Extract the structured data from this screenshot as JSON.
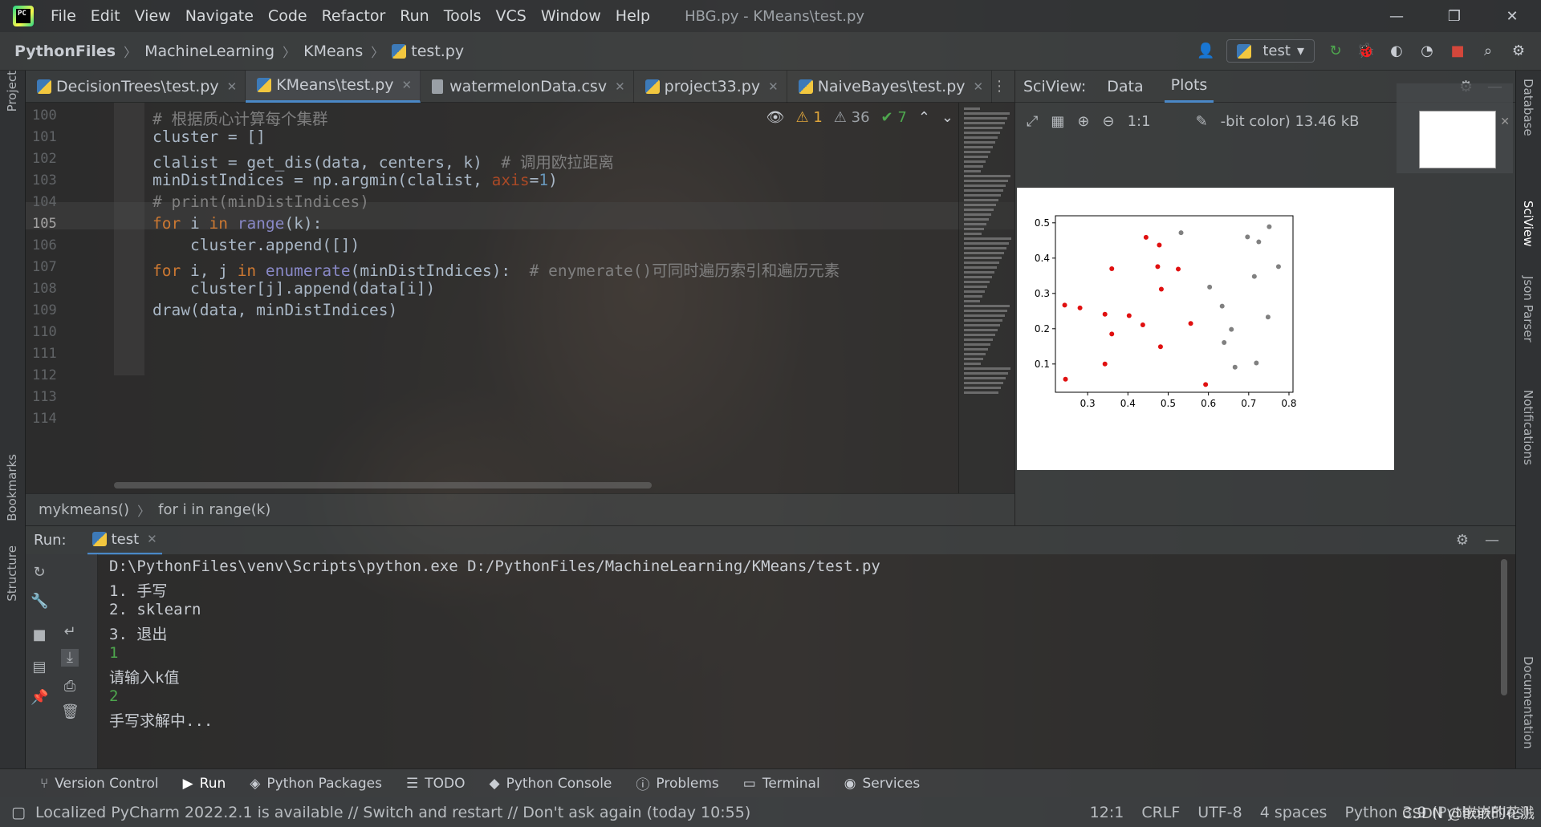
{
  "menubar": {
    "items": [
      "File",
      "Edit",
      "View",
      "Navigate",
      "Code",
      "Refactor",
      "Run",
      "Tools",
      "VCS",
      "Window",
      "Help"
    ],
    "title": "HBG.py - KMeans\\test.py",
    "minimize": "—",
    "restore": "❐",
    "close": "✕"
  },
  "navbar": {
    "crumbs": [
      "PythonFiles",
      "MachineLearning",
      "KMeans",
      "test.py"
    ],
    "run_config": "test"
  },
  "editor_tabs": [
    {
      "label": "DecisionTrees\\test.py"
    },
    {
      "label": "KMeans\\test.py",
      "active": true
    },
    {
      "label": "watermelonData.csv"
    },
    {
      "label": "project33.py"
    },
    {
      "label": "NaiveBayes\\test.py"
    }
  ],
  "inspections": {
    "warnings": "1",
    "weak_warnings": "36",
    "typos": "7"
  },
  "editor": {
    "line_numbers": [
      "100",
      "101",
      "102",
      "103",
      "104",
      "105",
      "106",
      "107",
      "108",
      "109",
      "110",
      "111",
      "112",
      "113",
      "114"
    ],
    "current_line": "105",
    "lines": [
      {
        "parts": [
          {
            "t": "# 根据质心计算每个集群",
            "c": "comment"
          }
        ]
      },
      {
        "parts": [
          {
            "t": "cluster = []",
            "c": ""
          }
        ]
      },
      {
        "parts": [
          {
            "t": "clalist = get_dis(data, centers, k)  ",
            "c": ""
          },
          {
            "t": "# 调用欧拉距离",
            "c": "comment"
          }
        ]
      },
      {
        "parts": [
          {
            "t": "minDistIndices = np.argmin(clalist, ",
            "c": ""
          },
          {
            "t": "axis",
            "c": "param"
          },
          {
            "t": "=",
            "c": ""
          },
          {
            "t": "1",
            "c": "num"
          },
          {
            "t": ")",
            "c": ""
          }
        ]
      },
      {
        "parts": [
          {
            "t": "# print(minDistIndices)",
            "c": "comment"
          }
        ]
      },
      {
        "parts": [
          {
            "t": "for",
            "c": "kw"
          },
          {
            "t": " i ",
            "c": ""
          },
          {
            "t": "in",
            "c": "kw"
          },
          {
            "t": " ",
            "c": ""
          },
          {
            "t": "range",
            "c": "fn"
          },
          {
            "t": "(k):",
            "c": ""
          }
        ]
      },
      {
        "parts": [
          {
            "t": "    cluster.append([])",
            "c": ""
          }
        ]
      },
      {
        "parts": [
          {
            "t": "for",
            "c": "kw"
          },
          {
            "t": " i, j ",
            "c": ""
          },
          {
            "t": "in",
            "c": "kw"
          },
          {
            "t": " ",
            "c": ""
          },
          {
            "t": "enumerate",
            "c": "fn"
          },
          {
            "t": "(minDistIndices):  ",
            "c": ""
          },
          {
            "t": "# enymerate()可同时遍历索引和遍历元素",
            "c": "comment"
          }
        ]
      },
      {
        "parts": [
          {
            "t": "    cluster[j].append(data[i])",
            "c": ""
          }
        ]
      },
      {
        "parts": [
          {
            "t": "draw(data, minDistIndices)",
            "c": ""
          }
        ]
      }
    ]
  },
  "code_crumbs": {
    "func": "mykmeans()",
    "stmt": "for i in range(k)"
  },
  "sciview": {
    "title": "SciView:",
    "tabs": [
      "Data",
      "Plots"
    ],
    "image_info": "-bit color) 13.46 kB",
    "zoom_label": "1:1"
  },
  "chart_data": {
    "type": "scatter",
    "xlim": [
      0.22,
      0.81
    ],
    "ylim": [
      0.02,
      0.52
    ],
    "xticks": [
      0.3,
      0.4,
      0.5,
      0.6,
      0.7,
      0.8
    ],
    "yticks": [
      0.1,
      0.2,
      0.3,
      0.4,
      0.5
    ],
    "series": [
      {
        "color": "#e01010",
        "points": [
          [
            0.243,
            0.267
          ],
          [
            0.245,
            0.057
          ],
          [
            0.281,
            0.259
          ],
          [
            0.343,
            0.241
          ],
          [
            0.343,
            0.1
          ],
          [
            0.36,
            0.37
          ],
          [
            0.36,
            0.185
          ],
          [
            0.403,
            0.237
          ],
          [
            0.437,
            0.211
          ],
          [
            0.445,
            0.459
          ],
          [
            0.474,
            0.376
          ],
          [
            0.478,
            0.437
          ],
          [
            0.481,
            0.149
          ],
          [
            0.483,
            0.312
          ],
          [
            0.525,
            0.369
          ],
          [
            0.556,
            0.215
          ],
          [
            0.593,
            0.042
          ]
        ]
      },
      {
        "color": "#808080",
        "points": [
          [
            0.532,
            0.472
          ],
          [
            0.603,
            0.318
          ],
          [
            0.634,
            0.264
          ],
          [
            0.639,
            0.161
          ],
          [
            0.657,
            0.198
          ],
          [
            0.666,
            0.091
          ],
          [
            0.697,
            0.46
          ],
          [
            0.714,
            0.348
          ],
          [
            0.719,
            0.103
          ],
          [
            0.725,
            0.446
          ],
          [
            0.748,
            0.233
          ],
          [
            0.751,
            0.489
          ],
          [
            0.774,
            0.376
          ]
        ]
      }
    ]
  },
  "run": {
    "label": "Run:",
    "tab": "test",
    "console": [
      {
        "text": "D:\\PythonFiles\\venv\\Scripts\\python.exe D:/PythonFiles/MachineLearning/KMeans/test.py",
        "input": false
      },
      {
        "text": "1. 手写",
        "input": false
      },
      {
        "text": "2. sklearn",
        "input": false
      },
      {
        "text": "3. 退出",
        "input": false
      },
      {
        "text": "1",
        "input": true
      },
      {
        "text": "请输入k值",
        "input": false
      },
      {
        "text": "2",
        "input": true
      },
      {
        "text": "手写求解中...",
        "input": false
      }
    ]
  },
  "toolwindows": [
    "Version Control",
    "Run",
    "Python Packages",
    "TODO",
    "Python Console",
    "Problems",
    "Terminal",
    "Services"
  ],
  "left_strip": [
    "Project",
    "Bookmarks",
    "Structure"
  ],
  "right_strip": [
    "Database",
    "SciView",
    "Json Parser",
    "Notifications",
    "Documentation"
  ],
  "status": {
    "message": "Localized PyCharm 2022.2.1 is available // Switch and restart // Don't ask again (today 10:55)",
    "position": "12:1",
    "line_sep": "CRLF",
    "encoding": "UTF-8",
    "indent": "4 spaces",
    "interpreter": "Python 3.9 (PythonFiles)"
  },
  "watermark": "CSDN @嵌嵌的花溅"
}
